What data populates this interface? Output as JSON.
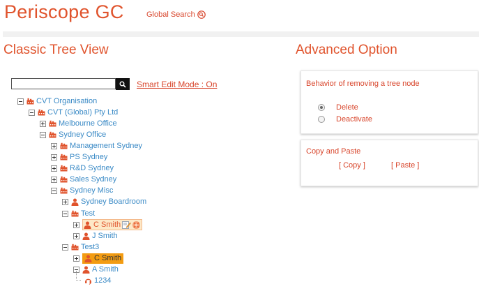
{
  "app": {
    "title": "Periscope GC",
    "global_search_label": "Global Search"
  },
  "left": {
    "title": "Classic Tree View",
    "search": {
      "value": "",
      "placeholder": ""
    },
    "smart_edit_label": "Smart Edit Mode : On"
  },
  "tree": [
    {
      "label": "CVT Organisation",
      "type": "org",
      "toggle": "minus",
      "level": 0
    },
    {
      "label": "CVT (Global) Pty Ltd",
      "type": "org",
      "toggle": "minus",
      "level": 1
    },
    {
      "label": "Melbourne Office",
      "type": "org",
      "toggle": "plus",
      "level": 2
    },
    {
      "label": "Sydney Office",
      "type": "org",
      "toggle": "minus",
      "level": 2
    },
    {
      "label": "Management Sydney",
      "type": "org",
      "toggle": "plus",
      "level": 3
    },
    {
      "label": "PS Sydney",
      "type": "org",
      "toggle": "plus",
      "level": 3
    },
    {
      "label": "R&D Sydney",
      "type": "org",
      "toggle": "plus",
      "level": 3
    },
    {
      "label": "Sales Sydney",
      "type": "org",
      "toggle": "plus",
      "level": 3
    },
    {
      "label": "Sydney Misc",
      "type": "org",
      "toggle": "minus",
      "level": 3
    },
    {
      "label": "Sydney Boardroom",
      "type": "person",
      "toggle": "plus",
      "level": 4
    },
    {
      "label": "Test",
      "type": "org",
      "toggle": "minus",
      "level": 4
    },
    {
      "label": "C Smith",
      "type": "person",
      "toggle": "plus",
      "level": 5,
      "highlight": "light",
      "edit_icons": true
    },
    {
      "label": "J Smith",
      "type": "person",
      "toggle": "plus",
      "level": 5
    },
    {
      "label": "Test3",
      "type": "org",
      "toggle": "minus",
      "level": 4
    },
    {
      "label": "C Smith",
      "type": "person",
      "toggle": "plus",
      "level": 5,
      "highlight": "strong"
    },
    {
      "label": "A Smith",
      "type": "person",
      "toggle": "minus",
      "level": 5
    },
    {
      "label": "1234",
      "type": "phone",
      "toggle": "none",
      "level": 6
    }
  ],
  "right": {
    "title": "Advanced Option",
    "remove_panel": {
      "title": "Behavior of removing a tree node",
      "options": [
        {
          "label": "Delete",
          "checked": true
        },
        {
          "label": "Deactivate",
          "checked": false
        }
      ]
    },
    "copy_panel": {
      "title": "Copy and Paste",
      "copy_label": "[ Copy ]",
      "paste_label": "[ Paste ]"
    }
  },
  "colors": {
    "accent": "#e0532c",
    "link": "#3a8ac6",
    "highlight": "#f39c12",
    "highlight_light": "#fde8c7"
  },
  "icons": {
    "search": "search-icon",
    "org": "org-icon",
    "person": "person-icon",
    "phone": "phone-icon",
    "edit": "edit-icon",
    "tools": "tools-icon"
  }
}
